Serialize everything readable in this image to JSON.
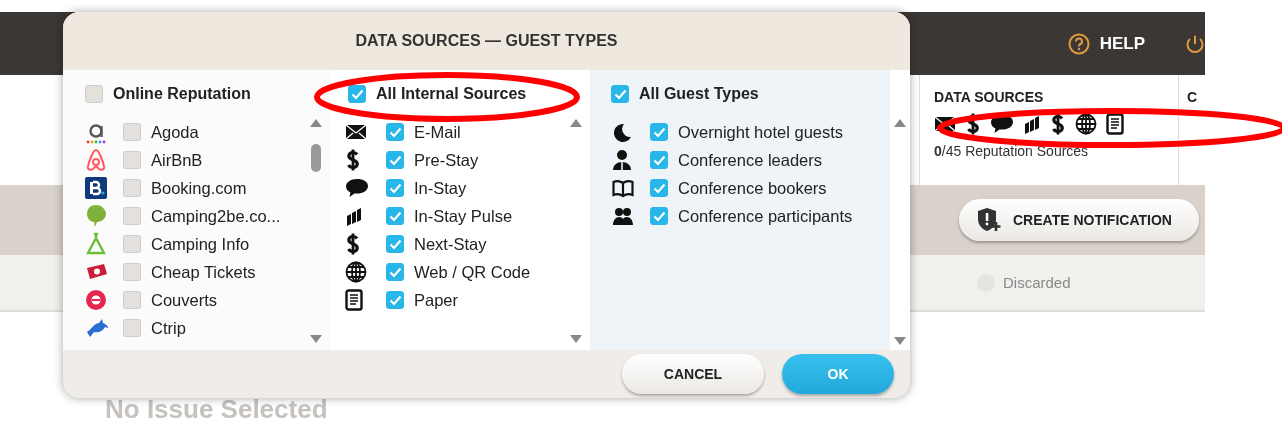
{
  "header": {
    "help": "HELP"
  },
  "data_sources_panel": {
    "title": "DATA SOURCES",
    "summary": "**0**/45 Reputation Sources"
  },
  "next_panel": {
    "title": "C"
  },
  "notification_button": {
    "label": "CREATE NOTIFICATION"
  },
  "filter": {
    "label": "Discarded",
    "selected": false
  },
  "issue_title": "No Issue Selected",
  "dialog": {
    "title": "DATA SOURCES — GUEST TYPES",
    "columns": [
      {
        "label": "Online Reputation",
        "checked": false,
        "items": [
          {
            "label": "Agoda",
            "checked": false
          },
          {
            "label": "AirBnB",
            "checked": false
          },
          {
            "label": "Booking.com",
            "checked": false
          },
          {
            "label": "Camping2be.co...",
            "checked": false
          },
          {
            "label": "Camping Info",
            "checked": false
          },
          {
            "label": "Cheap Tickets",
            "checked": false
          },
          {
            "label": "Couverts",
            "checked": false
          },
          {
            "label": "Ctrip",
            "checked": false
          }
        ]
      },
      {
        "label": "All Internal Sources",
        "checked": true,
        "items": [
          {
            "label": "E-Mail",
            "checked": true
          },
          {
            "label": "Pre-Stay",
            "checked": true
          },
          {
            "label": "In-Stay",
            "checked": true
          },
          {
            "label": "In-Stay Pulse",
            "checked": true
          },
          {
            "label": "Next-Stay",
            "checked": true
          },
          {
            "label": "Web / QR Code",
            "checked": true
          },
          {
            "label": "Paper",
            "checked": true
          }
        ]
      },
      {
        "label": "All Guest Types",
        "checked": true,
        "items": [
          {
            "label": "Overnight hotel guests",
            "checked": true
          },
          {
            "label": "Conference leaders",
            "checked": true
          },
          {
            "label": "Conference bookers",
            "checked": true
          },
          {
            "label": "Conference participants",
            "checked": true
          }
        ]
      }
    ],
    "buttons": [
      {
        "label": "CANCEL",
        "kind": "secondary"
      },
      {
        "label": "OK",
        "kind": "primary"
      }
    ]
  }
}
